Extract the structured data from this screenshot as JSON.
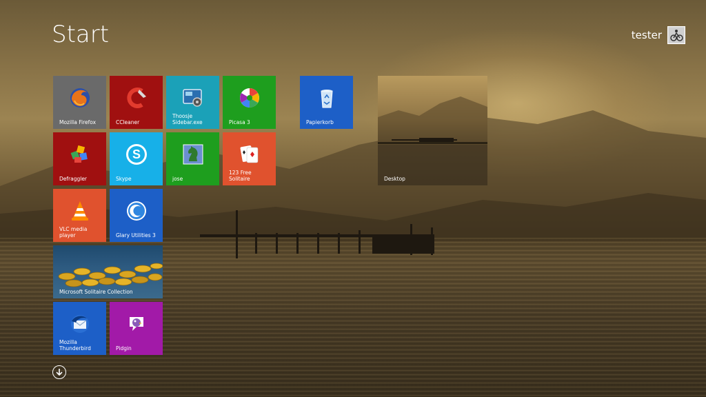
{
  "header": {
    "title": "Start",
    "user_name": "tester"
  },
  "tiles": [
    {
      "label": "Mozilla Firefox",
      "color": "#6a6a6a",
      "icon": "firefox-icon"
    },
    {
      "label": "CCleaner",
      "color": "#a01010",
      "icon": "ccleaner-icon"
    },
    {
      "label": "Thoosje Sidebar.exe",
      "color": "#1ba1b8",
      "icon": "sidebar-icon"
    },
    {
      "label": "Picasa 3",
      "color": "#1e9e1e",
      "icon": "picasa-icon"
    },
    {
      "label": "Papierkorb",
      "color": "#1d5fc7",
      "icon": "recycle-bin-icon"
    },
    {
      "label": "Desktop",
      "color": "#7a6a48",
      "icon": "desktop-icon"
    },
    {
      "label": "Defraggler",
      "color": "#a01010",
      "icon": "defraggler-icon"
    },
    {
      "label": "Skype",
      "color": "#17b0e8",
      "icon": "skype-icon"
    },
    {
      "label": "jose",
      "color": "#1e9e1e",
      "icon": "chess-knight-icon"
    },
    {
      "label": "123 Free Solitaire",
      "color": "#e0522e",
      "icon": "cards-icon"
    },
    {
      "label": "VLC media player",
      "color": "#e0522e",
      "icon": "vlc-cone-icon"
    },
    {
      "label": "Glary Utilities 3",
      "color": "#1d5fc7",
      "icon": "glary-icon"
    },
    {
      "label": "Microsoft Solitaire Collection",
      "color": "#2d5a80",
      "icon": "coins-icon"
    },
    {
      "label": "Mozilla Thunderbird",
      "color": "#1d5fc7",
      "icon": "thunderbird-icon"
    },
    {
      "label": "Pidgin",
      "color": "#a21aa8",
      "icon": "pidgin-icon"
    }
  ]
}
